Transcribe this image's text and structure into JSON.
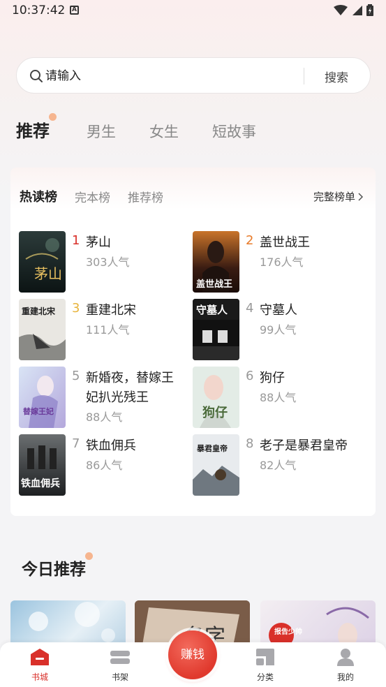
{
  "status": {
    "time": "10:37:42",
    "a_label": "A"
  },
  "search": {
    "placeholder": "请输入",
    "button": "搜索"
  },
  "tabs": [
    {
      "label": "推荐",
      "active": true
    },
    {
      "label": "男生"
    },
    {
      "label": "女生"
    },
    {
      "label": "短故事"
    }
  ],
  "rank": {
    "tabs": [
      {
        "label": "热读榜",
        "active": true
      },
      {
        "label": "完本榜"
      },
      {
        "label": "推荐榜"
      }
    ],
    "full_list": "完整榜单",
    "books": [
      {
        "rank": "1",
        "title": "茅山",
        "popularity": "303人气",
        "rank_color": "#d9302a"
      },
      {
        "rank": "2",
        "title": "盖世战王",
        "popularity": "176人气",
        "rank_color": "#e87b2a"
      },
      {
        "rank": "3",
        "title": "重建北宋",
        "popularity": "111人气",
        "rank_color": "#e8b43c"
      },
      {
        "rank": "4",
        "title": "守墓人",
        "popularity": "99人气",
        "rank_color": "#999999"
      },
      {
        "rank": "5",
        "title": "新婚夜，替嫁王妃扒光残王",
        "popularity": "88人气",
        "rank_color": "#999999"
      },
      {
        "rank": "6",
        "title": "狗仔",
        "popularity": "88人气",
        "rank_color": "#999999"
      },
      {
        "rank": "7",
        "title": "铁血佣兵",
        "popularity": "86人气",
        "rank_color": "#999999"
      },
      {
        "rank": "8",
        "title": "老子是暴君皇帝",
        "popularity": "82人气",
        "rank_color": "#999999"
      }
    ],
    "cover_texts": [
      "茅山",
      "盖世战王",
      "重建北宋",
      "守墓人",
      "替嫁王妃",
      "狗仔",
      "铁血佣兵",
      "暴君皇帝"
    ]
  },
  "today": {
    "title": "今日推荐",
    "rec_cover_texts": [
      "",
      "名字",
      "报告少帅"
    ]
  },
  "bottom_nav": [
    {
      "label": "书城",
      "active": true
    },
    {
      "label": "书架"
    },
    {
      "label": "赚钱"
    },
    {
      "label": "分类"
    },
    {
      "label": "我的"
    }
  ],
  "colors": {
    "accent": "#d9302a",
    "dot": "#f6b58f"
  }
}
